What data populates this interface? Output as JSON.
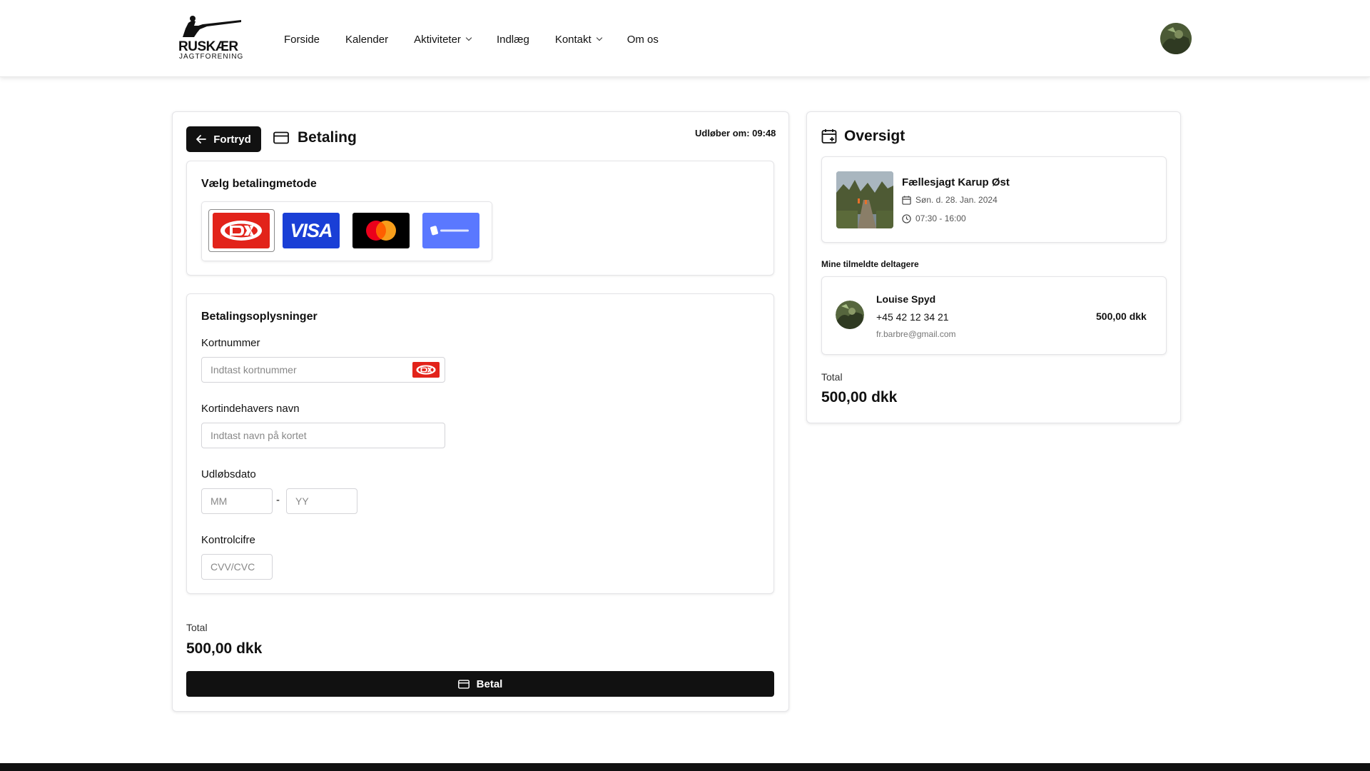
{
  "brand": {
    "name": "RUSKÆR",
    "sub": "JAGTFORENING"
  },
  "nav": [
    {
      "label": "Forside",
      "dropdown": false
    },
    {
      "label": "Kalender",
      "dropdown": false
    },
    {
      "label": "Aktiviteter",
      "dropdown": true
    },
    {
      "label": "Indlæg",
      "dropdown": false
    },
    {
      "label": "Kontakt",
      "dropdown": true
    },
    {
      "label": "Om os",
      "dropdown": false
    }
  ],
  "payment": {
    "back_label": "Fortryd",
    "title": "Betaling",
    "expires": "Udløber om: 09:48",
    "method_heading": "Vælg betalingmetode",
    "methods": [
      "Dankort",
      "VISA",
      "Mastercard",
      "MobilePay"
    ],
    "selected_method": "Dankort",
    "details_heading": "Betalingsoplysninger",
    "card_number": {
      "label": "Kortnummer",
      "placeholder": "Indtast kortnummer"
    },
    "card_holder": {
      "label": "Kortindehavers navn",
      "placeholder": "Indtast navn på kortet"
    },
    "expiry": {
      "label": "Udløbsdato",
      "month_placeholder": "MM",
      "separator": "-",
      "year_placeholder": "YY"
    },
    "cvc": {
      "label": "Kontrolcifre",
      "placeholder": "CVV/CVC"
    },
    "total_label": "Total",
    "total_value": "500,00 dkk",
    "pay_label": "Betal"
  },
  "overview": {
    "title": "Oversigt",
    "event": {
      "name": "Fællesjagt Karup Øst",
      "date": "Søn. d. 28. Jan. 2024",
      "time": "07:30 - 16:00"
    },
    "participants_heading": "Mine tilmeldte deltagere",
    "participant": {
      "name": "Louise Spyd",
      "phone": "+45 42 12 34 21",
      "email": "fr.barbre@gmail.com",
      "price": "500,00 dkk"
    },
    "total_label": "Total",
    "total_value": "500,00 dkk"
  },
  "colors": {
    "dankort_red": "#e2231a",
    "visa_blue": "#1a3fd6",
    "mastercard_bg": "#000000",
    "mobilepay_blue": "#5a78ff",
    "primary": "#111111"
  }
}
